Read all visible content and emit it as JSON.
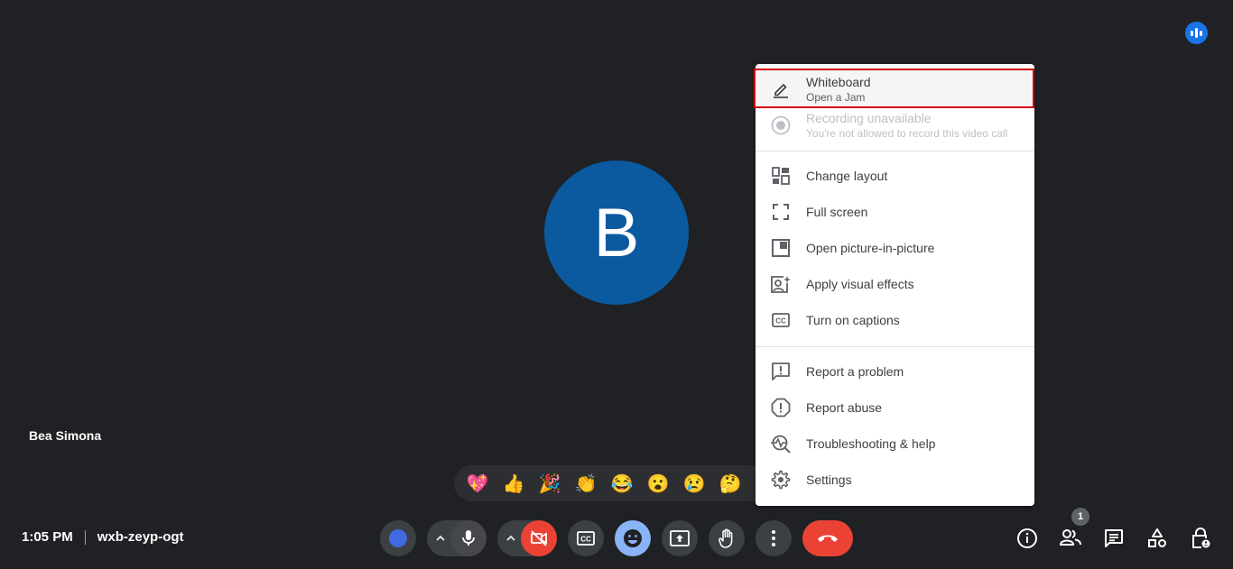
{
  "participant": {
    "initial": "B",
    "name": "Bea Simona",
    "avatar_color": "#0b5aa0"
  },
  "meeting": {
    "time": "1:05 PM",
    "code": "wxb-zeyp-ogt"
  },
  "reactions": [
    "💖",
    "👍",
    "🎉",
    "👏",
    "😂",
    "😮",
    "😢",
    "🤔"
  ],
  "menu": {
    "items": [
      {
        "label": "Whiteboard",
        "sub": "Open a Jam",
        "icon": "pencil-icon",
        "highlighted": true
      },
      {
        "label": "Recording unavailable",
        "sub": "You're not allowed to record this video call",
        "icon": "record-icon",
        "disabled": true
      },
      {
        "label": "Change layout",
        "icon": "layout-icon"
      },
      {
        "label": "Full screen",
        "icon": "fullscreen-icon"
      },
      {
        "label": "Open picture-in-picture",
        "icon": "pip-icon"
      },
      {
        "label": "Apply visual effects",
        "icon": "visual-effects-icon"
      },
      {
        "label": "Turn on captions",
        "icon": "captions-icon"
      },
      {
        "label": "Report a problem",
        "icon": "report-problem-icon"
      },
      {
        "label": "Report abuse",
        "icon": "report-abuse-icon"
      },
      {
        "label": "Troubleshooting & help",
        "icon": "troubleshoot-icon"
      },
      {
        "label": "Settings",
        "icon": "settings-icon"
      }
    ]
  },
  "people_count": "1",
  "colors": {
    "hangup": "#ea4335",
    "camera_off": "#ea4335",
    "reactions_active": "#8ab4f8",
    "accent": "#1a73e8"
  }
}
